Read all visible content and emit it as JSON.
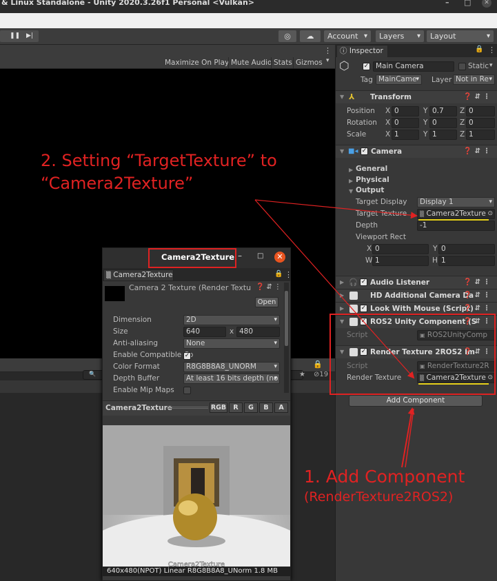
{
  "window": {
    "title": "& Linux Standalone - Unity 2020.3.26f1 Personal <Vulkan>",
    "min": "–",
    "max": "□",
    "close": "✕"
  },
  "toolbar": {
    "pause": "❚❚",
    "step": "▶|",
    "account": "Account",
    "layers": "Layers",
    "layout": "Layout"
  },
  "game": {
    "options": [
      "Maximize On Play",
      "Mute Audio",
      "Stats",
      "Gizmos"
    ],
    "menu_dots": "⋮"
  },
  "inspector": {
    "tab": "Inspector",
    "lock": "🔒",
    "object_name": "Main Camera",
    "static_label": "Static",
    "tag_label": "Tag",
    "tag_value": "MainCame",
    "layer_label": "Layer",
    "layer_value": "Not in Re",
    "transform": {
      "title": "Transform",
      "position_label": "Position",
      "rotation_label": "Rotation",
      "scale_label": "Scale",
      "position": [
        "0",
        "0.7",
        "0"
      ],
      "rotation": [
        "0",
        "0",
        "0"
      ],
      "scale": [
        "1",
        "1",
        "1"
      ],
      "axes": [
        "X",
        "Y",
        "Z"
      ]
    },
    "camera": {
      "title": "Camera",
      "general": "General",
      "physical": "Physical",
      "output": "Output",
      "target_display_label": "Target Display",
      "target_display": "Display 1",
      "target_texture_label": "Target Texture",
      "target_texture": "Camera2Texture",
      "depth_label": "Depth",
      "depth": "-1",
      "viewport_label": "Viewport Rect",
      "vp_x_label": "X",
      "vp_x": "0",
      "vp_y_label": "Y",
      "vp_y": "0",
      "vp_w_label": "W",
      "vp_w": "1",
      "vp_h_label": "H",
      "vp_h": "1"
    },
    "components": {
      "audio": "Audio Listener",
      "hdcam": "HD Additional Camera Da",
      "look": "Look With Mouse (Script)",
      "ros2": "ROS2 Unity Component (S",
      "ros2_script_label": "Script",
      "ros2_script": "ROS2UnityComp",
      "rt": "Render Texture 2ROS2 Im",
      "rt_script_label": "Script",
      "rt_script": "RenderTexture2R",
      "rt_tex_label": "Render Texture",
      "rt_tex": "Camera2Texture"
    },
    "add_component": "Add Component"
  },
  "texwin": {
    "title": "Camera2Texture",
    "tab": "Camera2Texture",
    "asset_name": "Camera 2 Texture (Render Textu",
    "open": "Open",
    "dimension_label": "Dimension",
    "dimension": "2D",
    "size_label": "Size",
    "size_w": "640",
    "size_x": "x",
    "size_h": "480",
    "aa_label": "Anti-aliasing",
    "aa": "None",
    "compat_label": "Enable Compatible Co",
    "color_label": "Color Format",
    "color": "R8G8B8A8_UNORM",
    "depth_label": "Depth Buffer",
    "depth": "At least 16 bits depth (no s",
    "mip_label": "Enable Mip Maps",
    "preview_label": "Camera2Texture",
    "channels": [
      "RGB",
      "R",
      "G",
      "B",
      "A"
    ],
    "preview_caption": "Camera2Texture",
    "status": "640x480(NPOT) Linear  R8G8B8A8_UNorm 1.8 MB"
  },
  "annotations": {
    "step2_line1": "2. Setting “TargetTexture” to",
    "step2_line2": "“Camera2Texture”",
    "step1_line1": "1. Add Component",
    "step1_line2": "(RenderTexture2ROS2)"
  },
  "colors": {
    "annotation": "#e02222",
    "highlight": "#e8d21c",
    "close_button": "#e9541f"
  }
}
